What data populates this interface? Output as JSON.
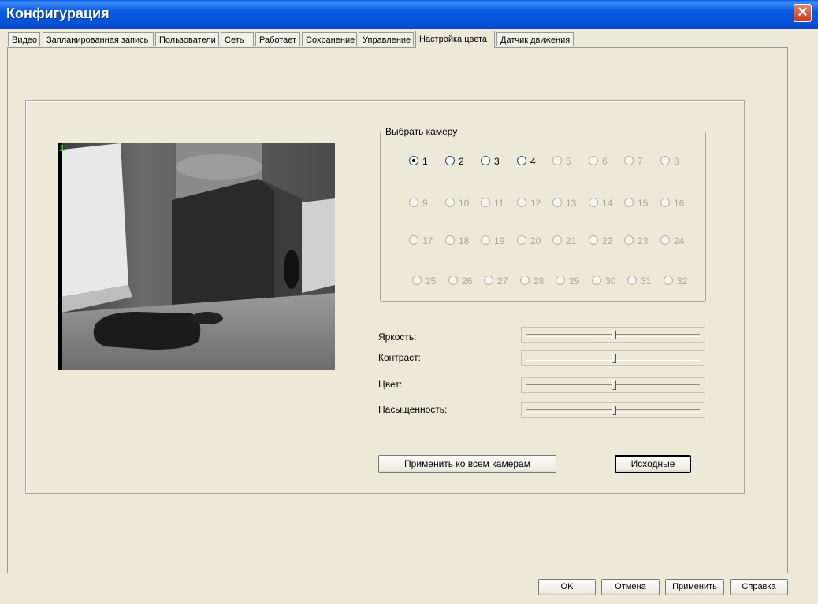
{
  "window": {
    "title": "Конфигурация"
  },
  "tabs": [
    {
      "label": "Видео"
    },
    {
      "label": "Запланированная запись"
    },
    {
      "label": "Пользователи"
    },
    {
      "label": "Сеть"
    },
    {
      "label": "Работает"
    },
    {
      "label": "Сохранение"
    },
    {
      "label": "Управление"
    },
    {
      "label": "Настройка цвета",
      "active": true
    },
    {
      "label": "Датчик движения"
    }
  ],
  "preview": {
    "channel_label": "1"
  },
  "camera_select": {
    "legend": "Выбрать камеру",
    "selected": "1",
    "cameras": [
      "1",
      "2",
      "3",
      "4",
      "5",
      "6",
      "7",
      "8",
      "9",
      "10",
      "11",
      "12",
      "13",
      "14",
      "15",
      "16",
      "17",
      "18",
      "19",
      "20",
      "21",
      "22",
      "23",
      "24",
      "25",
      "26",
      "27",
      "28",
      "29",
      "30",
      "31",
      "32"
    ],
    "enabled": [
      "1",
      "2",
      "3",
      "4"
    ]
  },
  "sliders": [
    {
      "label": "Яркость:",
      "value": 0.5
    },
    {
      "label": "Контраст:",
      "value": 0.5
    },
    {
      "label": "Цвет:",
      "value": 0.5
    },
    {
      "label": "Насыщенность:",
      "value": 0.5
    }
  ],
  "buttons": {
    "apply_all": "Применить ко всем камерам",
    "defaults": "Исходные",
    "ok": "OK",
    "cancel": "Отмена",
    "apply": "Применить",
    "help": "Справка"
  },
  "colors": {
    "titlebar": "#0553d6",
    "close": "#c8391b",
    "face": "#ece9d8"
  }
}
